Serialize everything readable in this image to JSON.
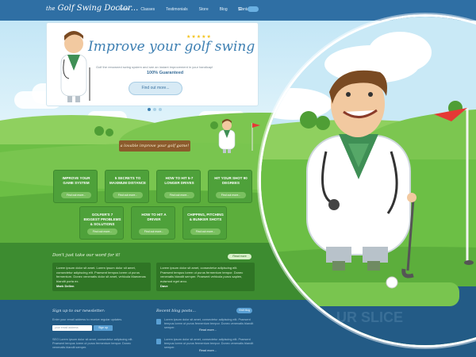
{
  "header": {
    "logo_prefix": "the",
    "logo_main": "Golf Swing Doctor",
    "logo_suffix": "...",
    "nav": [
      "Home",
      "Classes",
      "Testimonials",
      "Store",
      "Blog",
      "Contact"
    ],
    "cart": "$0"
  },
  "hero": {
    "stars": "★★★★★",
    "title": "Improve your golf swing",
    "subtitle": "Golf the renowned swing system and see an instant improvement in your handicap!",
    "guarantee": "100% Guaranteed",
    "button": "Find out more..."
  },
  "sign": "a lovable improve your golf game!",
  "features": [
    {
      "title": "IMPROVE YOUR GAME SYSTEM",
      "button": "Find out more..."
    },
    {
      "title": "5 SECRETS TO MAXIMUM DISTANCE",
      "button": "Find out more..."
    },
    {
      "title": "HOW TO HIT 5-7 LONGER DRIVES",
      "button": "Find out more..."
    },
    {
      "title": "HIT YOUR SHOT 90 DEGREES",
      "button": "Find out more..."
    },
    {
      "title": "GOLFER'S 7 BIGGEST PROBLEMS & SOLUTIONS",
      "button": "Find out more..."
    },
    {
      "title": "HOW TO HIT A DRIVER",
      "button": "Find out more..."
    },
    {
      "title": "CHIPPING, PITCHING & BUNKER SHOTS",
      "button": "Find out more..."
    }
  ],
  "testimonials": {
    "heading": "Don't just take our word for it!",
    "more": "Read more",
    "items": [
      {
        "text": "Lorem ipsum dolor sit amet. Lorem ipsum dolor sit amet, consectetur adipiscing elit. Praesent tempus lorem ut purus fermentum. Donec venenatis dolor sit amet, vehicula Maecenas blandit porta ex.",
        "author": "Mark Dellen"
      },
      {
        "text": "Lorem ipsum dolor sit amet, consectetur adipiscing elit. Praesent tempus lorem ut purus fermentum tempor. Donec venenatis blandit semper. Praesent vehicula purus sapien, euismod eget arcu.",
        "author": "Dave"
      }
    ]
  },
  "footer": {
    "newsletter_title": "Sign up to our newsletter:",
    "newsletter_text": "Enter your email address to receive regular updates.",
    "newsletter_placeholder": "your email address",
    "newsletter_button": "Sign up",
    "newsletter_body": "SEO Lorem ipsum dolor sit amet, consectetur adipiscing elit. Praesent tempus lorem ut purus fermentum tempor. Donec venenatis blandit semper.",
    "blog_title": "Recent blog posts...",
    "blog_more": "Visit blog",
    "posts": [
      {
        "text": "Lorem ipsum dolor sit amet, consectetur adipiscing elit. Praesent tempus lorem ut purus fermentum tempor. Donec venenatis blandit semper.",
        "link": "Read more..."
      },
      {
        "text": "Lorem ipsum dolor sit amet, consectetur adipiscing elit. Praesent tempus lorem ut purus fermentum tempor. Donec venenatis blandit semper.",
        "link": "Read more..."
      }
    ]
  },
  "colors": {
    "nav": "#2f6fa4",
    "sky": "#c3e6f6",
    "grass": "#6cbf45",
    "feature_box": "#4ea13a",
    "footer": "#235b86",
    "accent_blue": "#3d7fb2"
  }
}
